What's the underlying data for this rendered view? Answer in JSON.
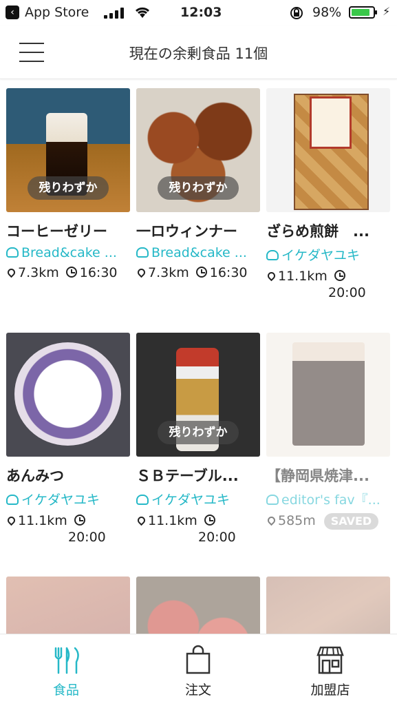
{
  "status_bar": {
    "back_app": "App Store",
    "time": "12:03",
    "battery_pct": "98%"
  },
  "header": {
    "title": "現在の余剰食品 11個"
  },
  "badge_low_stock": "残りわずか",
  "items": [
    {
      "name": "コーヒーゼリー",
      "shop": "Bread&cake ...",
      "distance": "7.3km",
      "time": "16:30",
      "low_stock": true
    },
    {
      "name": "一ロウィンナー",
      "shop": "Bread&cake ...",
      "distance": "7.3km",
      "time": "16:30",
      "low_stock": true
    },
    {
      "name": "ざらめ煎餅　...",
      "shop": "イケダヤユキ",
      "distance": "11.1km",
      "time": "20:00",
      "low_stock": false
    },
    {
      "name": "あんみつ",
      "shop": "イケダヤユキ",
      "distance": "11.1km",
      "time": "20:00",
      "low_stock": false
    },
    {
      "name": "ＳＢテーブル...",
      "shop": "イケダヤユキ",
      "distance": "11.1km",
      "time": "20:00",
      "low_stock": true
    },
    {
      "name": "【静岡県焼津...",
      "shop": "editor's fav『...",
      "distance": "585m",
      "saved_label": "SAVED",
      "low_stock": false
    }
  ],
  "tabs": [
    {
      "label": "食品",
      "icon": "fork-knife-icon",
      "active": true
    },
    {
      "label": "注文",
      "icon": "shopping-bag-icon",
      "active": false
    },
    {
      "label": "加盟店",
      "icon": "storefront-icon",
      "active": false
    }
  ],
  "colors": {
    "accent": "#25b8c7",
    "saved_badge": "#bdbdbd",
    "battery": "#3ac84a"
  }
}
